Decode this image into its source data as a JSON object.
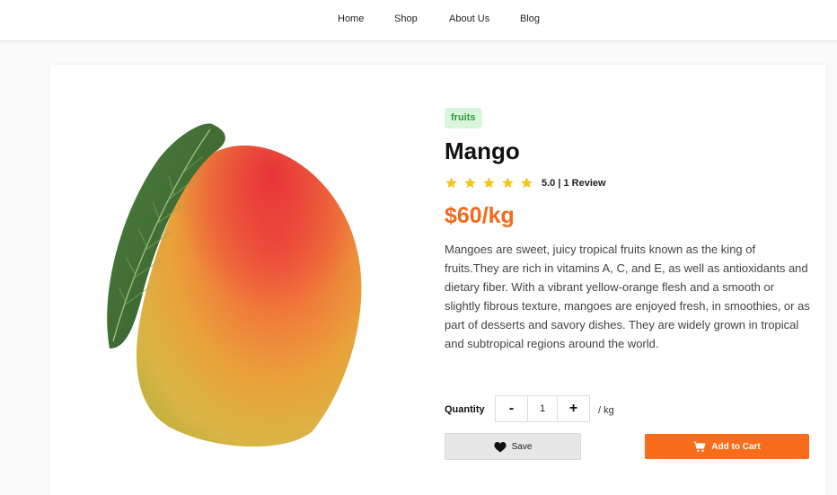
{
  "nav": {
    "items": [
      {
        "label": "Home"
      },
      {
        "label": "Shop"
      },
      {
        "label": "About Us"
      },
      {
        "label": "Blog"
      }
    ]
  },
  "product": {
    "category": "fruits",
    "name": "Mango",
    "rating": {
      "stars": 5,
      "max_stars": 5,
      "text": "5.0 | 1 Review"
    },
    "price": "$60/kg",
    "description": "Mangoes are sweet, juicy tropical fruits known as the king of fruits.They are rich in vitamins A, C, and E, as well as antioxidants and dietary fiber. With a vibrant yellow-orange flesh and a smooth or slightly fibrous texture, mangoes are enjoyed fresh, in smoothies, or as part of desserts and savory dishes. They are widely grown in tropical and subtropical regions around the world."
  },
  "quantity": {
    "label": "Quantity",
    "decrement": "-",
    "value": "1",
    "increment": "+",
    "unit": "/ kg"
  },
  "actions": {
    "save_label": "Save",
    "save_icon": "heart-icon",
    "cart_label": "Add to Cart",
    "cart_icon": "cart-icon"
  },
  "colors": {
    "accent": "#f86c1a",
    "price": "#f26a1b",
    "tag_bg": "#d9f5dc",
    "tag_text": "#2f9a3a",
    "star": "#f5c518"
  }
}
